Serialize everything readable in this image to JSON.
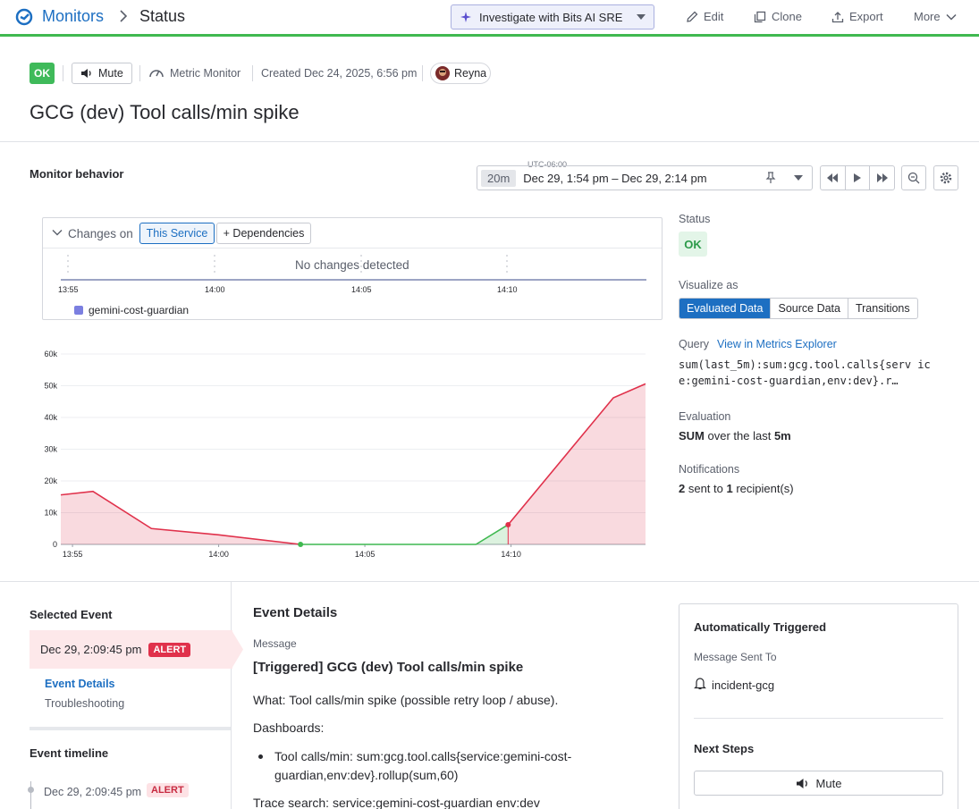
{
  "breadcrumb": {
    "root": "Monitors",
    "current": "Status"
  },
  "toolbar": {
    "bits_label": "Investigate with Bits AI SRE",
    "edit": "Edit",
    "clone": "Clone",
    "export": "Export",
    "more": "More"
  },
  "header": {
    "status": "OK",
    "mute": "Mute",
    "monitor_type": "Metric Monitor",
    "created": "Created Dec 24, 2025, 6:56 pm",
    "user": "Reyna",
    "title": "GCG (dev) Tool calls/min spike"
  },
  "behavior": {
    "title": "Monitor behavior",
    "timezone": "UTC-06:00",
    "range_chip": "20m",
    "range_text": "Dec 29, 1:54 pm – Dec 29, 2:14 pm"
  },
  "changes": {
    "title": "Changes on",
    "this_service": "This Service",
    "dependencies": "+ Dependencies",
    "empty": "No changes detected",
    "ticks": [
      "13:55",
      "14:00",
      "14:05",
      "14:10"
    ],
    "legend": "gemini-cost-guardian"
  },
  "side": {
    "status_label": "Status",
    "status_value": "OK",
    "visualize_label": "Visualize as",
    "viz_options": [
      "Evaluated Data",
      "Source Data",
      "Transitions"
    ],
    "viz_selected": "Evaluated Data",
    "query_label": "Query",
    "query_link": "View in Metrics Explorer",
    "query_text": "sum(last_5m):sum:gcg.tool.calls{serv ice:gemini-cost-guardian,env:dev}.r…",
    "evaluation_label": "Evaluation",
    "evaluation_agg": "SUM",
    "evaluation_mid": " over the last ",
    "evaluation_window": "5m",
    "notifications_label": "Notifications",
    "notif_sent": "2",
    "notif_mid": " sent to ",
    "notif_recipients": "1",
    "notif_tail": " recipient(s)"
  },
  "chart_data": {
    "type": "area",
    "x_ticks": [
      "13:55",
      "14:00",
      "14:05",
      "14:10"
    ],
    "y_ticks": [
      "0",
      "10k",
      "20k",
      "30k",
      "40k",
      "50k",
      "60k"
    ],
    "ylim": [
      0,
      60000
    ],
    "x_domain_minutes": [
      54.6,
      74.6
    ],
    "series": [
      {
        "name": "alert",
        "color": "#e0314b",
        "points": [
          [
            54.6,
            15600
          ],
          [
            55.7,
            16700
          ],
          [
            57.7,
            5000
          ],
          [
            60.0,
            3000
          ],
          [
            62.8,
            0
          ]
        ]
      },
      {
        "name": "ok",
        "color": "#3fb950",
        "points": [
          [
            62.8,
            0
          ],
          [
            68.8,
            0
          ],
          [
            69.9,
            6200
          ]
        ]
      },
      {
        "name": "alert",
        "color": "#e0314b",
        "points": [
          [
            69.9,
            6200
          ],
          [
            73.5,
            46200
          ],
          [
            74.6,
            50600
          ]
        ]
      }
    ],
    "markers": [
      {
        "x": 62.8,
        "y": 0,
        "color": "#3fb950"
      },
      {
        "x": 69.9,
        "y": 6200,
        "color": "#e0314b"
      }
    ]
  },
  "selected_event": {
    "title": "Selected Event",
    "time": "Dec 29, 2:09:45 pm",
    "badge": "ALERT",
    "tabs": [
      "Event Details",
      "Troubleshooting"
    ]
  },
  "timeline": {
    "title": "Event timeline",
    "items": [
      {
        "time": "Dec 29, 2:09:45 pm",
        "badge": "ALERT"
      }
    ]
  },
  "event_details": {
    "title": "Event Details",
    "message_label": "Message",
    "heading": "[Triggered] GCG (dev) Tool calls/min spike",
    "what": "What: Tool calls/min spike (possible retry loop / abuse).",
    "dashboards": "Dashboards:",
    "bullet_line1": "Tool calls/min: sum:gcg.tool.calls{service:gemini-cost-",
    "bullet_line2": "guardian,env:dev}.rollup(sum,60)",
    "trace": "Trace search: service:gemini-cost-guardian env:dev"
  },
  "auto": {
    "title": "Automatically Triggered",
    "sent_label": "Message Sent To",
    "target": "incident-gcg",
    "next_steps": "Next Steps",
    "mute": "Mute"
  }
}
